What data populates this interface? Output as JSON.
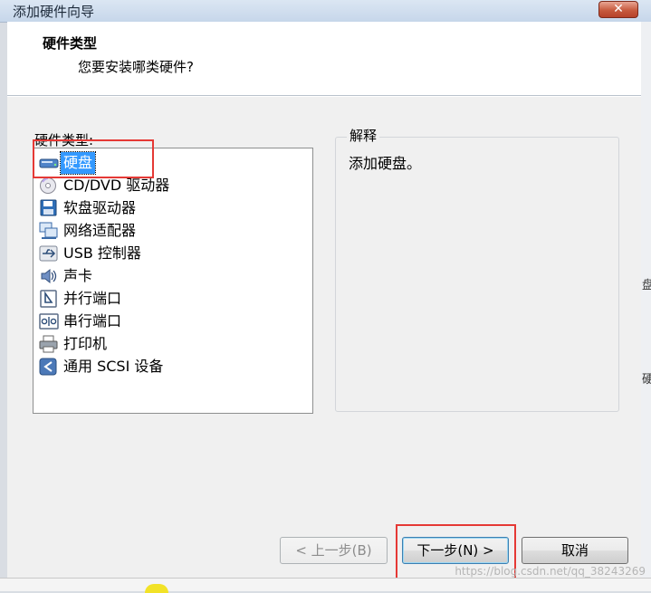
{
  "window": {
    "title": "添加硬件向导",
    "close_label": "✕"
  },
  "header": {
    "title": "硬件类型",
    "subtitle": "您要安装哪类硬件?"
  },
  "hardware": {
    "label": "硬件类型:",
    "items": [
      {
        "label": "硬盘",
        "icon": "hard-disk-icon",
        "selected": true
      },
      {
        "label": "CD/DVD 驱动器",
        "icon": "cd-dvd-icon"
      },
      {
        "label": "软盘驱动器",
        "icon": "floppy-icon"
      },
      {
        "label": "网络适配器",
        "icon": "network-adapter-icon"
      },
      {
        "label": "USB 控制器",
        "icon": "usb-icon"
      },
      {
        "label": "声卡",
        "icon": "sound-card-icon"
      },
      {
        "label": "并行端口",
        "icon": "parallel-port-icon"
      },
      {
        "label": "串行端口",
        "icon": "serial-port-icon"
      },
      {
        "label": "打印机",
        "icon": "printer-icon"
      },
      {
        "label": "通用 SCSI 设备",
        "icon": "scsi-icon"
      }
    ]
  },
  "explanation": {
    "legend": "解释",
    "text": "添加硬盘。"
  },
  "buttons": {
    "back": "< 上一步(B)",
    "next": "下一步(N) >",
    "cancel": "取消"
  },
  "watermark": "https://blog.csdn.net/qq_38243269",
  "colors": {
    "selection": "#3399ff",
    "highlight_box": "#e53935"
  }
}
